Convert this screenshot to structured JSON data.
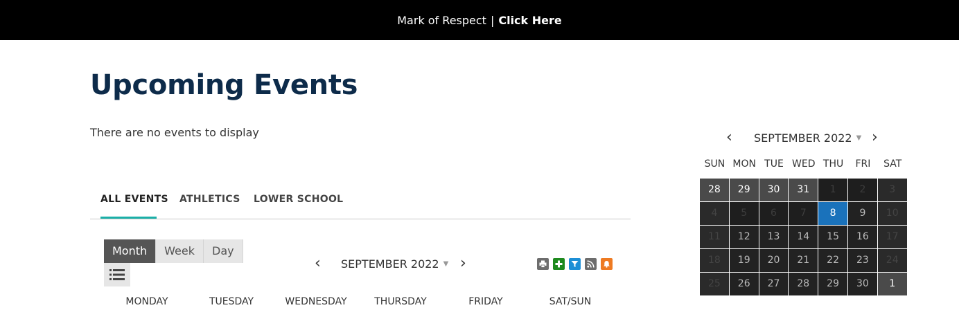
{
  "banner": {
    "text": "Mark of Respect",
    "separator": "|",
    "link_label": "Click Here"
  },
  "page": {
    "title": "Upcoming Events",
    "no_events": "There are no events to display"
  },
  "tabs": [
    {
      "label": "ALL EVENTS",
      "active": true
    },
    {
      "label": "ATHLETICS",
      "active": false
    },
    {
      "label": "LOWER SCHOOL",
      "active": false
    }
  ],
  "views": [
    {
      "label": "Month",
      "active": true
    },
    {
      "label": "Week",
      "active": false
    },
    {
      "label": "Day",
      "active": false
    }
  ],
  "calendar": {
    "month_label": "SEPTEMBER 2022",
    "prev": "‹",
    "next": "›",
    "caret": "▼",
    "tools": [
      "print-icon",
      "add-icon",
      "filter-icon",
      "rss-icon",
      "bell-icon"
    ],
    "tool_colors": [
      "#6d6d6d",
      "#1e8a1e",
      "#1d8fd6",
      "#6d6d6d",
      "#ee7a22"
    ],
    "day_names": [
      "MONDAY",
      "TUESDAY",
      "WEDNESDAY",
      "THURSDAY",
      "FRIDAY",
      "SAT/SUN"
    ]
  },
  "mini_calendar": {
    "month_label": "SEPTEMBER 2022",
    "prev": "‹",
    "next": "›",
    "caret": "▼",
    "weekdays": [
      "SUN",
      "MON",
      "TUE",
      "WED",
      "THU",
      "FRI",
      "SAT"
    ],
    "weeks": [
      [
        "28",
        "29",
        "30",
        "31",
        "1",
        "2",
        "3"
      ],
      [
        "4",
        "5",
        "6",
        "7",
        "8",
        "9",
        "10"
      ],
      [
        "11",
        "12",
        "13",
        "14",
        "15",
        "16",
        "17"
      ],
      [
        "18",
        "19",
        "20",
        "21",
        "22",
        "23",
        "24"
      ],
      [
        "25",
        "26",
        "27",
        "28",
        "29",
        "30",
        "1"
      ]
    ],
    "today": "8",
    "colors": {
      "today": "#1a72bb"
    }
  }
}
